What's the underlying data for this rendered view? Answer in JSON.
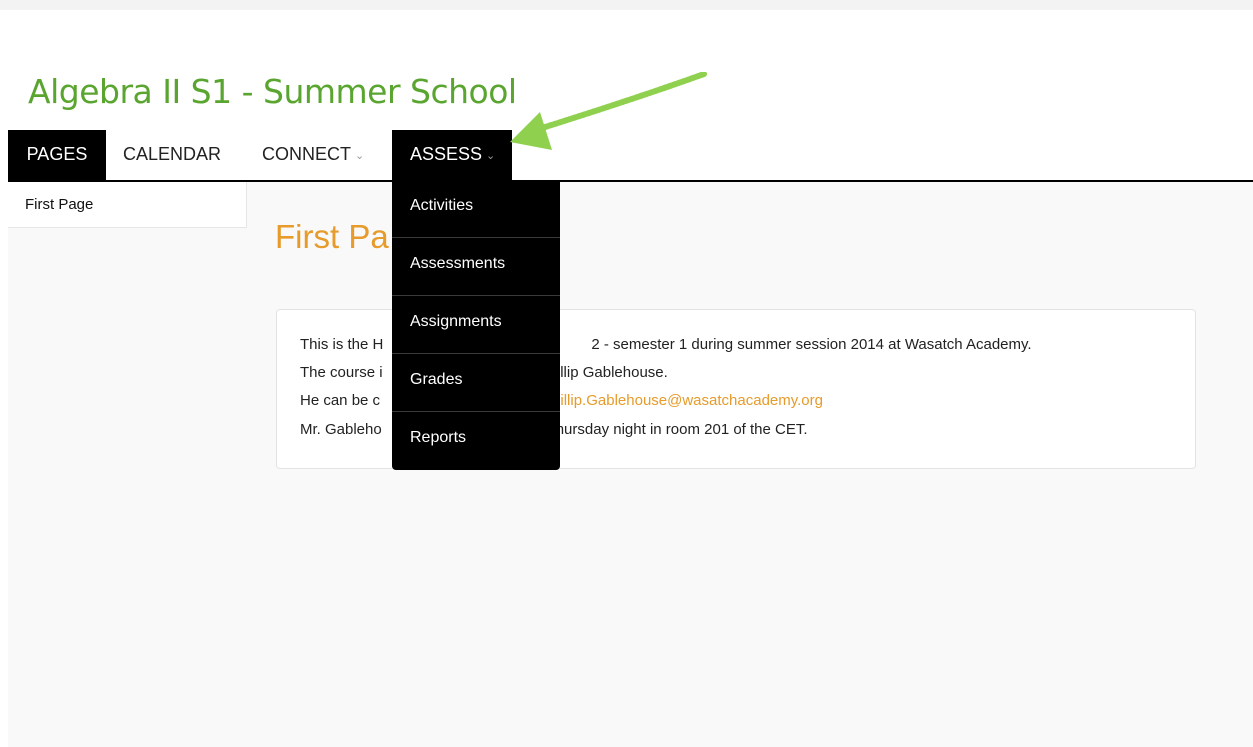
{
  "header": {
    "title": "Algebra II S1 - Summer School"
  },
  "nav": {
    "pages": "PAGES",
    "calendar": "CALENDAR",
    "connect": "CONNECT",
    "assess": "ASSESS"
  },
  "sidebar": {
    "items": [
      "First Page"
    ]
  },
  "main": {
    "heading": "First Pa",
    "lines": [
      {
        "pre": "This is the H",
        "post": "2 - semester 1 during summer session 2014 at Wasatch Academy."
      },
      {
        "pre": "The course i",
        "post": "Phillip Gablehouse."
      },
      {
        "pre": "He can be c",
        "link": "hillip.Gablehouse@wasatchacademy.org"
      },
      {
        "pre": "Mr. Gableho",
        "post": "hursday night in room 201 of the CET."
      }
    ]
  },
  "assess_menu": {
    "items": [
      "Activities",
      "Assessments",
      "Assignments",
      "Grades",
      "Reports"
    ]
  },
  "colors": {
    "title_green": "#5aa530",
    "heading_orange": "#e69b2a",
    "arrow_green": "#8fd14f"
  },
  "icons": {
    "dropdown": "chevron-down-icon",
    "annotation": "arrow-annotation-icon"
  }
}
